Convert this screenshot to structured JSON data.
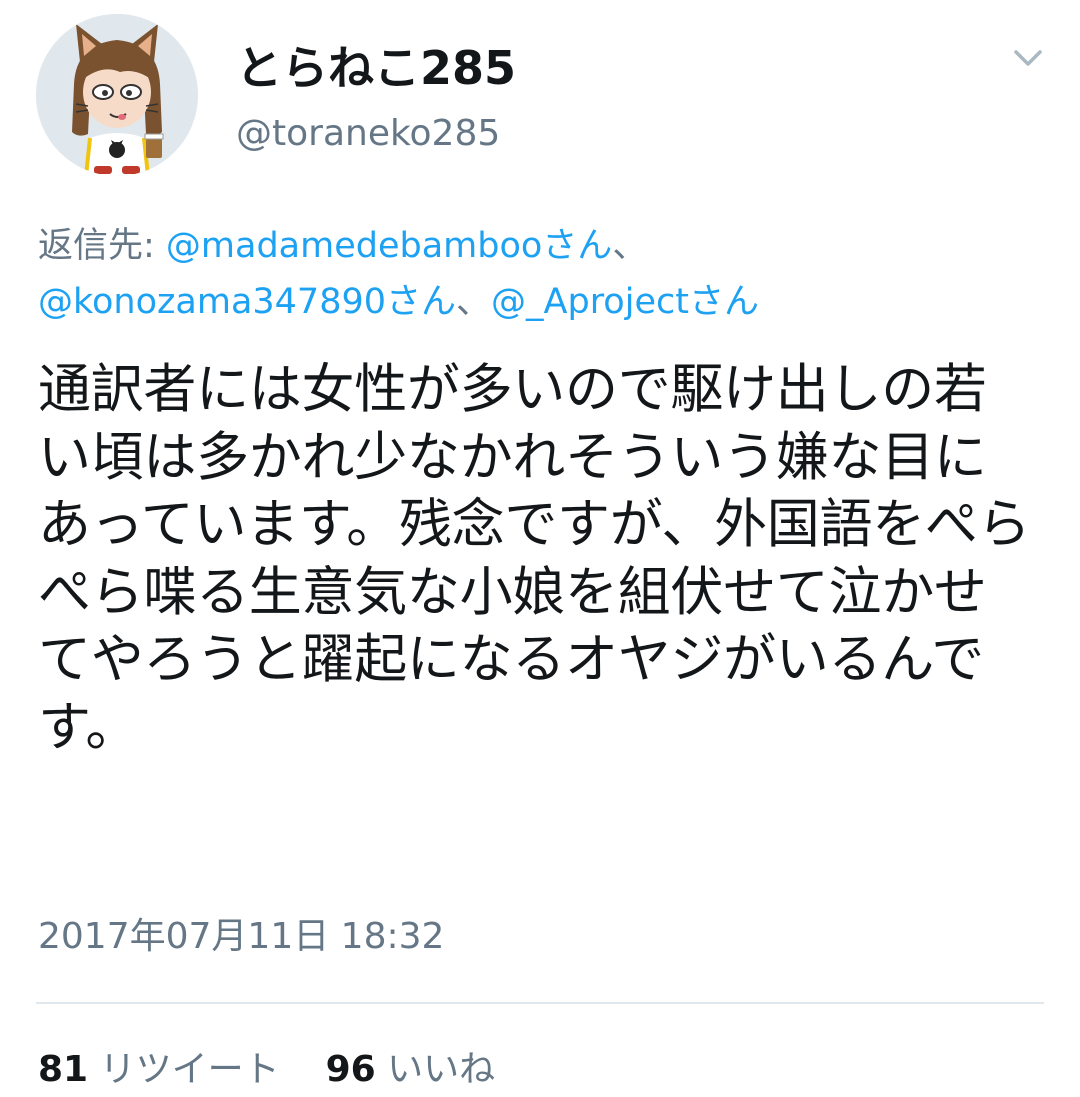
{
  "tweet": {
    "display_name": "とらねこ285",
    "handle": "@toraneko285",
    "reply_prefix": "返信先: ",
    "reply_mentions": [
      "@madamedebambooさん",
      "@konozama347890さん",
      "@_Aprojectさん"
    ],
    "reply_separator": "、",
    "text": "通訳者には女性が多いので駆け出しの若い頃は多かれ少なかれそういう嫌な目にあっています。残念ですが、外国語をぺらぺら喋る生意気な小娘を組伏せて泣かせてやろうと躍起になるオヤジがいるんです。",
    "timestamp": "2017年07月11日 18:32",
    "retweet_count": "81",
    "retweet_label": "リツイート",
    "like_count": "96",
    "like_label": "いいね"
  },
  "icons": {
    "menu": "chevron-down-icon",
    "avatar": "cartoon-cat-eared-girl-avatar"
  },
  "colors": {
    "link": "#1da1f2",
    "secondary_text": "#657786",
    "divider": "#e1e8ed"
  }
}
